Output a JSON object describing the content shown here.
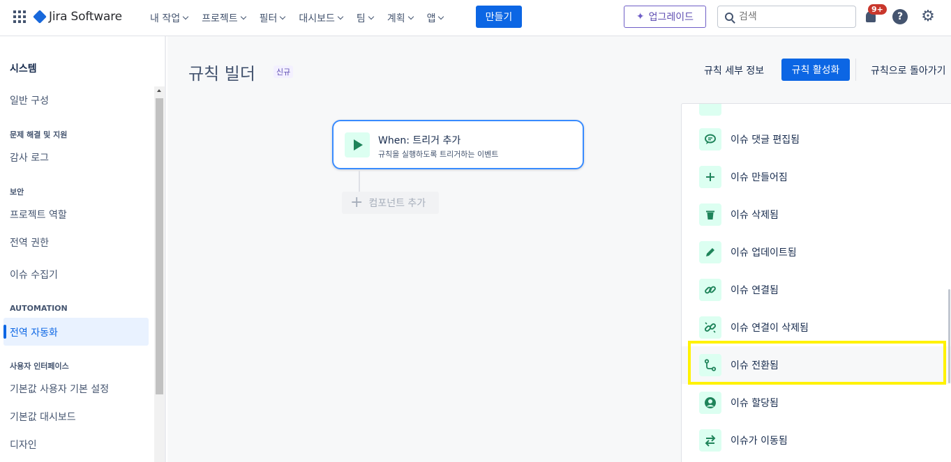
{
  "topnav": {
    "app_name": "Jira Software",
    "menu": [
      {
        "label": "내 작업"
      },
      {
        "label": "프로젝트"
      },
      {
        "label": "필터"
      },
      {
        "label": "대시보드"
      },
      {
        "label": "팀"
      },
      {
        "label": "계획"
      },
      {
        "label": "앱"
      }
    ],
    "create_label": "만들기",
    "upgrade_label": "업그레이드",
    "search_placeholder": "검색",
    "notification_badge": "9+",
    "help_glyph": "?"
  },
  "sidebar": {
    "title": "시스템",
    "general_config": "일반 구성",
    "section_troubleshoot": "문제 해결 및 지원",
    "audit_log": "감사 로그",
    "section_security": "보안",
    "project_roles": "프로젝트 역할",
    "global_permissions": "전역 권한",
    "issue_collectors": "이슈 수집기",
    "section_automation": "AUTOMATION",
    "global_automation": "전역 자동화",
    "section_ui": "사용자 인터페이스",
    "default_user_prefs": "기본값 사용자 기본 설정",
    "default_dashboard": "기본값 대시보드",
    "design": "디자인"
  },
  "builder": {
    "title": "규칙 빌더",
    "new_lozenge": "신규",
    "rule_details": "규칙 세부 정보",
    "enable_rule": "규칙 활성화",
    "back_to_rules": "규칙으로 돌아가기",
    "trigger_title": "When: 트리거 추가",
    "trigger_subtitle": "규칙을 실행하도록 트리거하는 이벤트",
    "add_component": "컴포넌트 추가"
  },
  "panel": {
    "items": [
      {
        "label": "이슈 댓글 편집됨",
        "icon": "comment-edit-icon"
      },
      {
        "label": "이슈 만들어짐",
        "icon": "plus-icon"
      },
      {
        "label": "이슈 삭제됨",
        "icon": "trash-icon"
      },
      {
        "label": "이슈 업데이트됨",
        "icon": "pencil-icon"
      },
      {
        "label": "이슈 연결됨",
        "icon": "link-icon"
      },
      {
        "label": "이슈 연결이 삭제됨",
        "icon": "unlink-icon"
      },
      {
        "label": "이슈 전환됨",
        "icon": "transition-icon"
      },
      {
        "label": "이슈 할당됨",
        "icon": "person-icon"
      },
      {
        "label": "이슈가 이동됨",
        "icon": "move-icon"
      }
    ]
  },
  "colors": {
    "primary": "#0c66e4",
    "icon_green": "#1f845a",
    "icon_bg": "#dcfff1",
    "highlight": "#fff200"
  }
}
